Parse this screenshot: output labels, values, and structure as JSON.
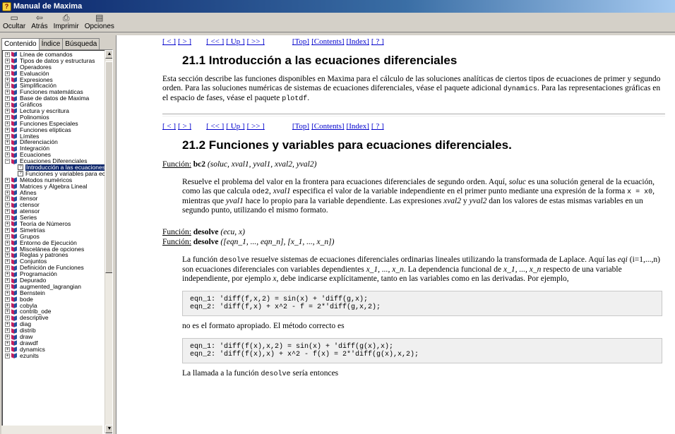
{
  "window": {
    "title": "Manual de Maxima"
  },
  "toolbar": {
    "buttons": [
      {
        "label": "Ocultar"
      },
      {
        "label": "Atrás"
      },
      {
        "label": "Imprimir"
      },
      {
        "label": "Opciones"
      }
    ]
  },
  "tabs": [
    "Contenido",
    "Índice",
    "Búsqueda"
  ],
  "tree": {
    "items": [
      {
        "label": "Línea de comandos"
      },
      {
        "label": "Tipos de datos y estructuras"
      },
      {
        "label": "Operadores"
      },
      {
        "label": "Evaluación"
      },
      {
        "label": "Expresiones"
      },
      {
        "label": "Simplificación"
      },
      {
        "label": "Funciones matemáticas"
      },
      {
        "label": "Base de datos de Maxima"
      },
      {
        "label": "Gráficos"
      },
      {
        "label": "Lectura y escritura"
      },
      {
        "label": "Polinomios"
      },
      {
        "label": "Funciones Especiales"
      },
      {
        "label": "Funciones elípticas"
      },
      {
        "label": "Límites"
      },
      {
        "label": "Diferenciación"
      },
      {
        "label": "Integración"
      },
      {
        "label": "Ecuaciones"
      },
      {
        "label": "Ecuaciones Diferenciales"
      },
      {
        "label": "Introducción a las ecuaciones diferenciales"
      },
      {
        "label": "Funciones y variables para ecuaciones diferenciales"
      },
      {
        "label": "Métodos numéricos"
      },
      {
        "label": "Matrices y Álgebra Lineal"
      },
      {
        "label": "Afines"
      },
      {
        "label": "itensor"
      },
      {
        "label": "ctensor"
      },
      {
        "label": "atensor"
      },
      {
        "label": "Series"
      },
      {
        "label": "Teoría de Números"
      },
      {
        "label": "Simetrías"
      },
      {
        "label": "Grupos"
      },
      {
        "label": "Entorno de Ejecución"
      },
      {
        "label": "Miscelánea de opciones"
      },
      {
        "label": "Reglas y patrones"
      },
      {
        "label": "Conjuntos"
      },
      {
        "label": "Definición de Funciones"
      },
      {
        "label": "Programación"
      },
      {
        "label": "Depurado"
      },
      {
        "label": "augmented_lagrangian"
      },
      {
        "label": "Bernstein"
      },
      {
        "label": "bode"
      },
      {
        "label": "cobyla"
      },
      {
        "label": "contrib_ode"
      },
      {
        "label": "descriptive"
      },
      {
        "label": "diag"
      },
      {
        "label": "distrib"
      },
      {
        "label": "draw"
      },
      {
        "label": "drawdf"
      },
      {
        "label": "dynamics"
      },
      {
        "label": "ezunits"
      }
    ]
  },
  "nav": {
    "prev": "[ < ]",
    "next": "[ > ]",
    "fastback": "[ << ]",
    "up": "[ Up ]",
    "fastforward": "[ >> ]",
    "top": "[Top]",
    "contents": "[Contents]",
    "index": "[Index]",
    "about": "[ ? ]"
  },
  "content": {
    "h1": "21.1 Introducción a las ecuaciones diferenciales",
    "intro_a": "Esta sección describe las funciones disponibles en Maxima para el cálculo de las soluciones analíticas de ciertos tipos de ecuaciones de primer y segundo orden. Para las soluciones numéricas de sistemas de ecuaciones diferenciales, véase el paquete adicional ",
    "intro_dynamics": "dynamics",
    "intro_b": ". Para las representaciones gráficas en el espacio de fases, véase el paquete ",
    "intro_plotdf": "plotdf",
    "intro_c": ".",
    "h2": "21.2 Funciones y variables para ecuaciones diferenciales.",
    "fn_label": "Función:",
    "bc2_name": "bc2",
    "bc2_args": "(soluc, xval1, yval1, xval2, yval2)",
    "bc2_p1": "Resuelve el problema del valor en la frontera para ecuaciones diferenciales de segundo orden. Aquí, ",
    "bc2_soluc": "soluc",
    "bc2_p2": " es una solución general de la ecuación, como las que calcula ",
    "bc2_ode2": "ode2",
    "bc2_p3": ", ",
    "bc2_xval1": "xval1",
    "bc2_p4": " especifica el valor de la variable independiente en el primer punto mediante una expresión de la forma ",
    "bc2_expr": "x = x0",
    "bc2_p5": ", mientras que ",
    "bc2_yval1": "yval1",
    "bc2_p6": " hace lo propio para la variable dependiente. Las expresiones ",
    "bc2_xval2": "xval2",
    "bc2_p7": " y ",
    "bc2_yval2": "yval2",
    "bc2_p8": " dan los valores de estas mismas variables en un segundo punto, utilizando el mismo formato.",
    "desolve_name": "desolve",
    "desolve_args1": "(ecu, x)",
    "desolve_args2": "([eqn_1, ..., eqn_n], [x_1, ..., x_n])",
    "ds_p1": "La función ",
    "ds_name": "desolve",
    "ds_p2": " resuelve sistemas de ecuaciones diferenciales ordinarias lineales utilizando la transformada de Laplace. Aquí las ",
    "ds_eqi": "eqi",
    "ds_p3": " (",
    "ds_range": "i=1,...,n",
    "ds_p4": ") son ecuaciones diferenciales con variables dependientes ",
    "ds_xs": "x_1, ..., x_n",
    "ds_p5": ". La dependencia funcional de ",
    "ds_xs2": "x_1, ..., x_n",
    "ds_p6": " respecto de una variable independiente, por ejemplo ",
    "ds_x": "x",
    "ds_p7": ", debe indicarse explícitamente, tanto en las variables como en las derivadas. Por ejemplo,",
    "code1": "eqn_1: 'diff(f,x,2) = sin(x) + 'diff(g,x);\neqn_2: 'diff(f,x) + x^2 - f = 2*'diff(g,x,2);",
    "not_right": "no es el formato apropiado. El método correcto es",
    "code2": "eqn_1: 'diff(f(x),x,2) = sin(x) + 'diff(g(x),x);\neqn_2: 'diff(f(x),x) + x^2 - f(x) = 2*'diff(g(x),x,2);",
    "call_a": "La llamada a la función ",
    "call_name": "desolve",
    "call_b": " sería entonces"
  }
}
